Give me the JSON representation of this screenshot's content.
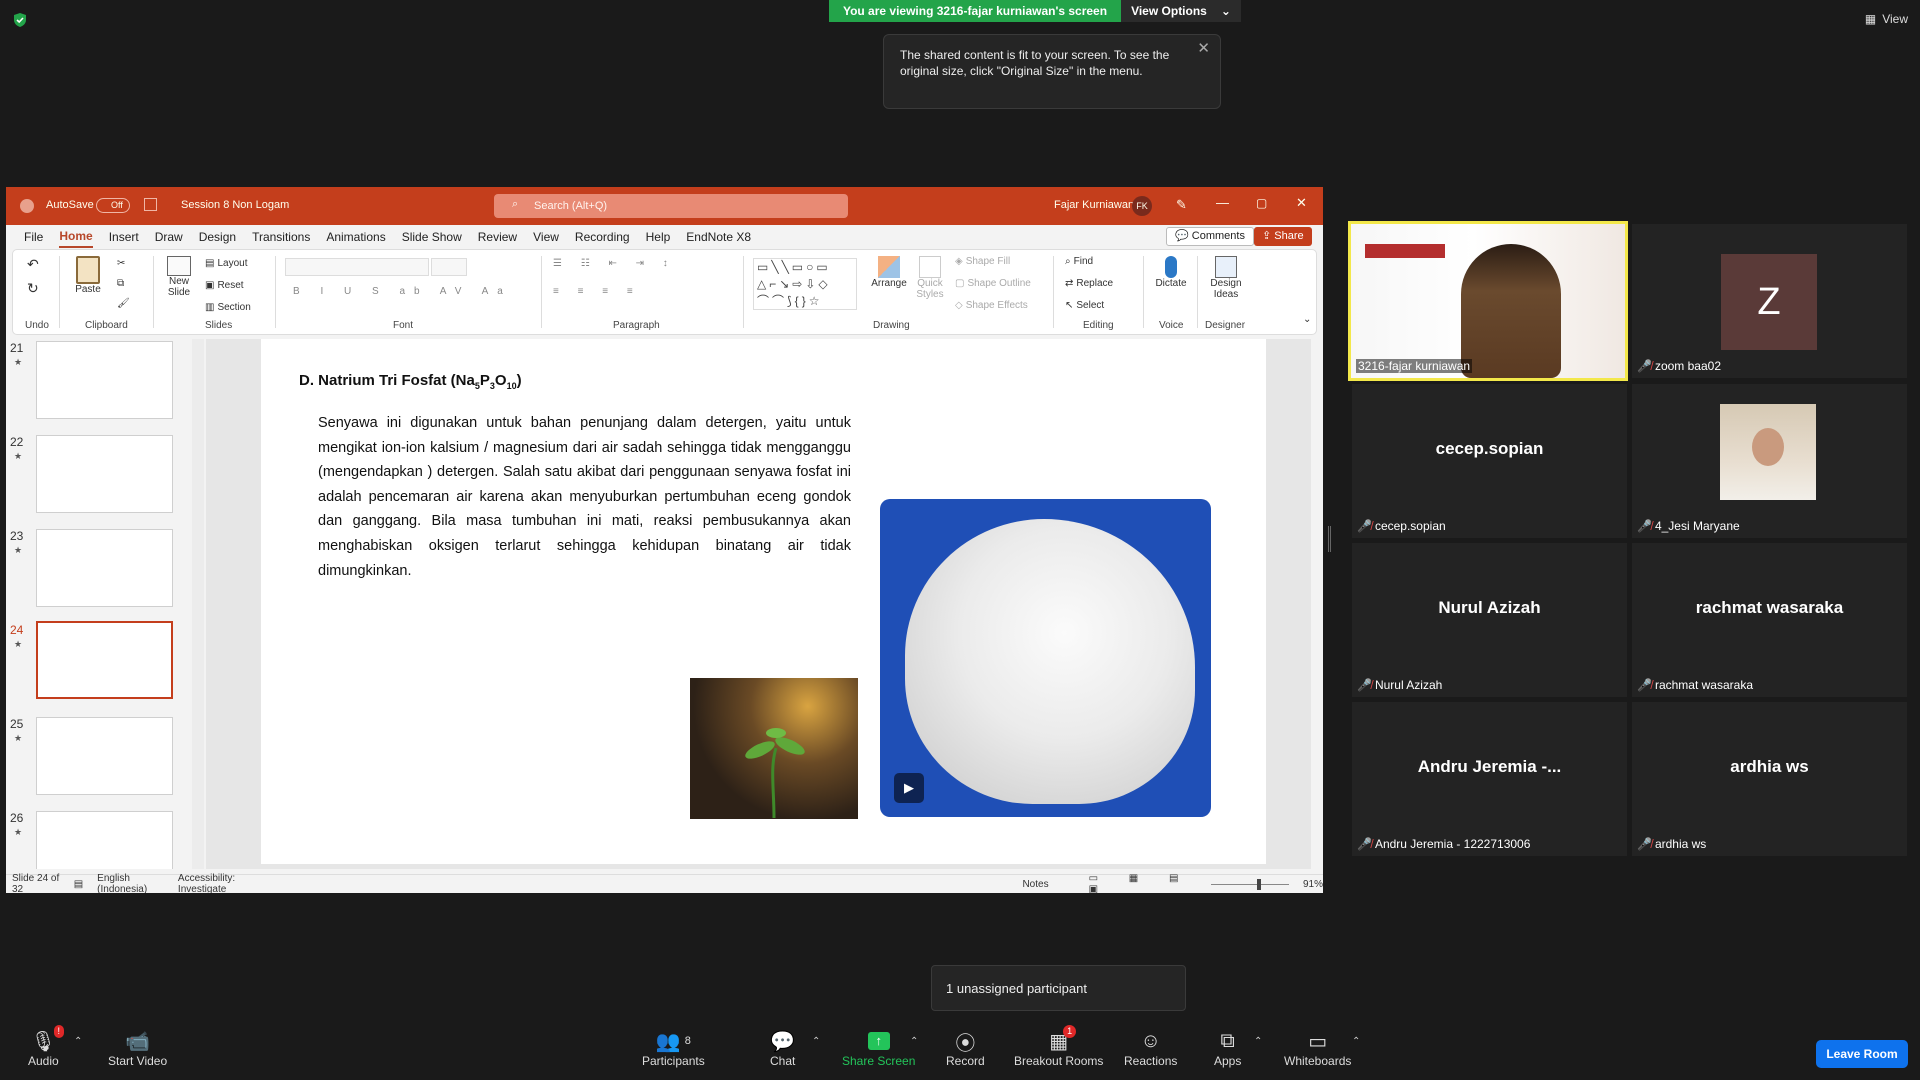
{
  "banner": {
    "viewing_text": "You are viewing 3216-fajar kurniawan's screen",
    "view_options": "View Options",
    "view_label": "View"
  },
  "tooltip": {
    "text": "The shared content is fit to your screen. To see the original size, click \"Original Size\" in the menu."
  },
  "ppt": {
    "autosave": "AutoSave",
    "autosave_state": "Off",
    "doc_title": "Session 8 Non Logam",
    "search_placeholder": "Search (Alt+Q)",
    "user_name": "Fajar Kurniawan",
    "user_initials": "FK",
    "menu": [
      "File",
      "Home",
      "Insert",
      "Draw",
      "Design",
      "Transitions",
      "Animations",
      "Slide Show",
      "Review",
      "View",
      "Recording",
      "Help",
      "EndNote X8"
    ],
    "comments": "Comments",
    "share": "Share",
    "ribbon": {
      "undo": "Undo",
      "paste": "Paste",
      "clipboard": "Clipboard",
      "new_slide": "New Slide",
      "layout": "Layout",
      "reset": "Reset",
      "section": "Section",
      "slides": "Slides",
      "font": "Font",
      "paragraph": "Paragraph",
      "arrange": "Arrange",
      "quick_styles": "Quick Styles",
      "shape_fill": "Shape Fill",
      "shape_outline": "Shape Outline",
      "shape_effects": "Shape Effects",
      "drawing": "Drawing",
      "find": "Find",
      "replace": "Replace",
      "select": "Select",
      "editing": "Editing",
      "dictate": "Dictate",
      "voice": "Voice",
      "design_ideas": "Design Ideas",
      "designer": "Designer"
    },
    "thumbnails": [
      "21",
      "22",
      "23",
      "24",
      "25",
      "26"
    ],
    "selected_slide": "24",
    "slide": {
      "heading_main": "D. Natrium Tri Fosfat (Na",
      "heading_sub1": "5",
      "heading_p": "P",
      "heading_sub2": "3",
      "heading_o": "O",
      "heading_sub3": "10",
      "heading_close": ")",
      "body": "Senyawa ini digunakan untuk bahan penunjang dalam detergen, yaitu untuk mengikat ion-ion kalsium / magnesium dari air sadah sehingga tidak mengganggu (mengendapkan ) detergen. Salah satu akibat dari penggunaan senyawa fosfat ini adalah pencemaran air karena akan menyuburkan pertumbuhan eceng gondok dan ganggang. Bila masa tumbuhan ini mati, reaksi pembusukannya akan menghabiskan oksigen terlarut sehingga kehidupan binatang air tidak dimungkinkan."
    },
    "status": {
      "slide_count": "Slide 24 of 32",
      "language": "English (Indonesia)",
      "accessibility": "Accessibility: Investigate",
      "notes": "Notes",
      "zoom": "91%"
    }
  },
  "gallery": [
    {
      "label": "3216-fajar kurniawan",
      "name": "",
      "type": "video",
      "active": true
    },
    {
      "label": "zoom baa02",
      "name": "Z",
      "type": "avatar-letter"
    },
    {
      "label": "cecep.sopian",
      "name": "cecep.sopian",
      "type": "name"
    },
    {
      "label": "4_Jesi Maryane",
      "name": "",
      "type": "avatar-photo"
    },
    {
      "label": "Nurul Azizah",
      "name": "Nurul Azizah",
      "type": "name"
    },
    {
      "label": "rachmat wasaraka",
      "name": "rachmat wasaraka",
      "type": "name"
    },
    {
      "label": "Andru Jeremia - 1222713006",
      "name": "Andru Jeremia -...",
      "type": "name"
    },
    {
      "label": "ardhia ws",
      "name": "ardhia ws",
      "type": "name"
    }
  ],
  "unassigned": "1 unassigned participant",
  "toolbar": {
    "audio": "Audio",
    "audio_badge": "!",
    "start_video": "Start Video",
    "participants": "Participants",
    "participants_count": "8",
    "chat": "Chat",
    "share_screen": "Share Screen",
    "record": "Record",
    "breakout_rooms": "Breakout Rooms",
    "breakout_badge": "1",
    "reactions": "Reactions",
    "apps": "Apps",
    "whiteboards": "Whiteboards",
    "leave_room": "Leave Room"
  }
}
